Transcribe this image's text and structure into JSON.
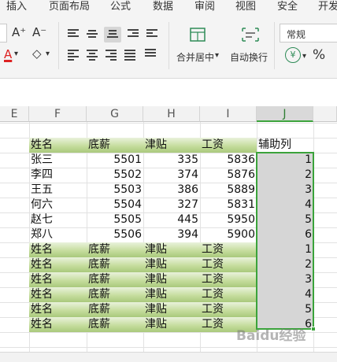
{
  "menu": {
    "items": [
      "插入",
      "页面布局",
      "公式",
      "数据",
      "审阅",
      "视图",
      "安全",
      "开发"
    ]
  },
  "ribbon": {
    "font_grow": "A⁺",
    "font_shrink": "A⁻",
    "font_color": "A",
    "eraser": "◇",
    "merge_center_label": "合并居中",
    "wrap_text_label": "自动换行",
    "number_format": "常规",
    "currency_symbol": "¥",
    "percent_symbol": "%",
    "dropdown_arrow": "▾"
  },
  "sheet": {
    "columns": [
      "E",
      "F",
      "G",
      "H",
      "I",
      "J"
    ],
    "selected_column": "J",
    "header_row": [
      "姓名",
      "底薪",
      "津贴",
      "工资",
      "辅助列"
    ],
    "rows": [
      {
        "name": "张三",
        "base": "5501",
        "allowance": "335",
        "salary": "5836",
        "helper": "1"
      },
      {
        "name": "李四",
        "base": "5502",
        "allowance": "374",
        "salary": "5876",
        "helper": "2"
      },
      {
        "name": "王五",
        "base": "5503",
        "allowance": "386",
        "salary": "5889",
        "helper": "3"
      },
      {
        "name": "何六",
        "base": "5504",
        "allowance": "327",
        "salary": "5831",
        "helper": "4"
      },
      {
        "name": "赵七",
        "base": "5505",
        "allowance": "445",
        "salary": "5950",
        "helper": "5"
      },
      {
        "name": "郑八",
        "base": "5506",
        "allowance": "394",
        "salary": "5900",
        "helper": "6"
      }
    ],
    "repeat_rows": [
      {
        "name": "姓名",
        "base": "底薪",
        "allowance": "津贴",
        "salary": "工资",
        "helper": "1"
      },
      {
        "name": "姓名",
        "base": "底薪",
        "allowance": "津贴",
        "salary": "工资",
        "helper": "2"
      },
      {
        "name": "姓名",
        "base": "底薪",
        "allowance": "津贴",
        "salary": "工资",
        "helper": "3"
      },
      {
        "name": "姓名",
        "base": "底薪",
        "allowance": "津贴",
        "salary": "工资",
        "helper": "4"
      },
      {
        "name": "姓名",
        "base": "底薪",
        "allowance": "津贴",
        "salary": "工资",
        "helper": "5"
      },
      {
        "name": "姓名",
        "base": "底薪",
        "allowance": "津贴",
        "salary": "工资",
        "helper": "6"
      }
    ],
    "header_band_color": "#b5d18c",
    "selection_color": "#3ba33b",
    "watermark": "Baidu经验"
  }
}
